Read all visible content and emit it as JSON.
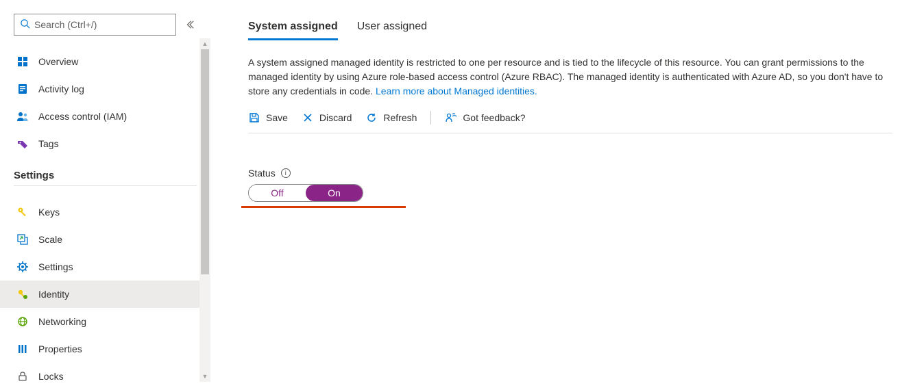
{
  "search": {
    "placeholder": "Search (Ctrl+/)"
  },
  "sidebar": {
    "top_items": [
      {
        "label": "Overview",
        "icon": "overview-icon"
      },
      {
        "label": "Activity log",
        "icon": "activity-log-icon"
      },
      {
        "label": "Access control (IAM)",
        "icon": "access-control-icon"
      },
      {
        "label": "Tags",
        "icon": "tags-icon"
      }
    ],
    "settings_header": "Settings",
    "settings_items": [
      {
        "label": "Keys",
        "icon": "keys-icon"
      },
      {
        "label": "Scale",
        "icon": "scale-icon"
      },
      {
        "label": "Settings",
        "icon": "settings-icon"
      },
      {
        "label": "Identity",
        "icon": "identity-icon",
        "active": true
      },
      {
        "label": "Networking",
        "icon": "networking-icon"
      },
      {
        "label": "Properties",
        "icon": "properties-icon"
      },
      {
        "label": "Locks",
        "icon": "locks-icon"
      }
    ]
  },
  "tabs": {
    "system_assigned": "System assigned",
    "user_assigned": "User assigned"
  },
  "description": {
    "text": "A system assigned managed identity is restricted to one per resource and is tied to the lifecycle of this resource. You can grant permissions to the managed identity by using Azure role-based access control (Azure RBAC). The managed identity is authenticated with Azure AD, so you don't have to store any credentials in code. ",
    "link": "Learn more about Managed identities."
  },
  "toolbar": {
    "save": "Save",
    "discard": "Discard",
    "refresh": "Refresh",
    "feedback": "Got feedback?"
  },
  "status": {
    "label": "Status",
    "off": "Off",
    "on": "On",
    "value": "On"
  }
}
